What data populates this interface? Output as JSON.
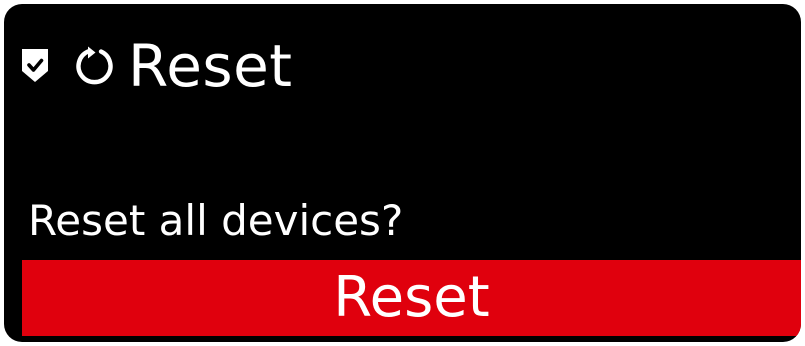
{
  "header": {
    "title": "Reset",
    "status_icon": "shield-check-icon",
    "title_icon": "reset-icon"
  },
  "dialog": {
    "question": "Reset all devices?"
  },
  "actions": {
    "reset_label": "Reset"
  },
  "colors": {
    "background": "#000000",
    "accent": "#e0000d",
    "text": "#ffffff"
  }
}
